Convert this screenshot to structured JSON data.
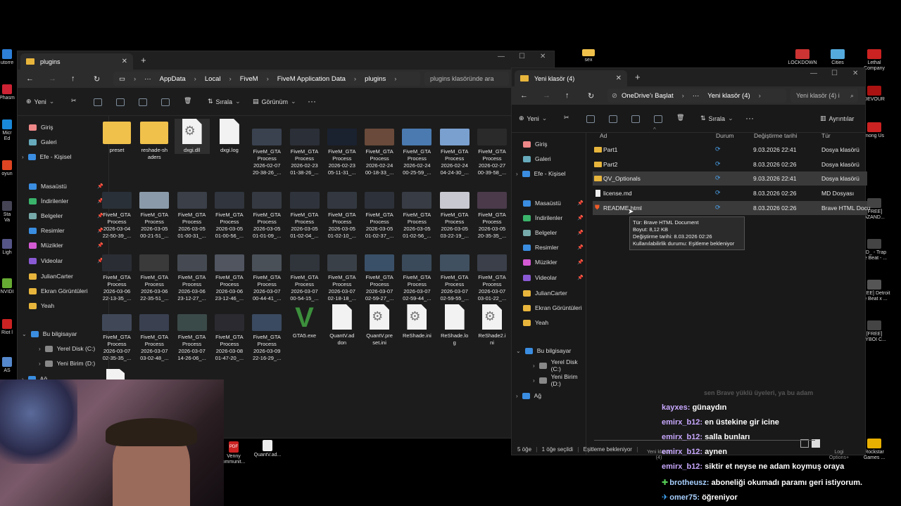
{
  "desktop_left": [
    {
      "label": "utorre",
      "color": "#2d7fd8"
    },
    {
      "label": "Phasm",
      "color": "#c23"
    },
    {
      "label": "Micr\nEd",
      "color": "#1a88d8"
    },
    {
      "label": "oyun",
      "color": "#d42"
    },
    {
      "label": "Sta\nVa",
      "color": "#445"
    },
    {
      "label": "Ligh",
      "color": "#558"
    },
    {
      "label": "NVIDI",
      "color": "#6a3"
    },
    {
      "label": "Riot l",
      "color": "#c22"
    },
    {
      "label": "AS",
      "color": "#58c"
    }
  ],
  "desktop_top": [
    {
      "label": "sex"
    }
  ],
  "desktop_right": [
    {
      "label": "LOCKDOWN",
      "color": "#c33"
    },
    {
      "label": "Cities",
      "color": "#5ad"
    },
    {
      "label": "Lethal\nCompany",
      "color": "#c22"
    },
    {
      "label": "DEVOUR",
      "color": "#a11"
    },
    {
      "label": "mong Us",
      "color": "#c22"
    },
    {
      "label": "[FREE]\nAZAND...",
      "color": "#444"
    },
    {
      "label": "ND_ - Trap\nne Beat - ...",
      "color": "#444"
    },
    {
      "label": "[FREE] Detroit\npe Beat x ...",
      "color": "#555"
    },
    {
      "label": "[FREE]\nAYBOI C...",
      "color": "#444"
    },
    {
      "label": "Rockstar\nGames ...",
      "color": "#e8b000"
    }
  ],
  "left_window": {
    "tab_title": "plugins",
    "path": [
      "AppData",
      "Local",
      "FiveM",
      "FiveM Application Data",
      "plugins"
    ],
    "search_placeholder": "plugins klasöründe ara",
    "toolbar": {
      "new": "Yeni",
      "sort": "Sırala",
      "view": "Görünüm",
      "more": "···"
    },
    "sidebar": [
      {
        "label": "Giriş",
        "color": "#e88",
        "pin": false
      },
      {
        "label": "Galeri",
        "color": "#6ab",
        "pin": false
      },
      {
        "label": "Efe - Kişisel",
        "color": "#3a8de0",
        "pin": false
      },
      {
        "label": "Masaüstü",
        "color": "#3a8de0",
        "pin": true
      },
      {
        "label": "İndirilenler",
        "color": "#3ab36b",
        "pin": true
      },
      {
        "label": "Belgeler",
        "color": "#7aa",
        "pin": true
      },
      {
        "label": "Resimler",
        "color": "#3a8de0",
        "pin": true
      },
      {
        "label": "Müzikler",
        "color": "#d45ad4",
        "pin": true
      },
      {
        "label": "Videolar",
        "color": "#8a5ad4",
        "pin": true
      },
      {
        "label": "JulianCarter",
        "color": "#e8b53c",
        "pin": false
      },
      {
        "label": "Ekran Görüntüleri",
        "color": "#e8b53c",
        "pin": false
      },
      {
        "label": "Yeah",
        "color": "#e8b53c",
        "pin": false
      },
      {
        "label": "Bu bilgisayar",
        "color": "#3a8de0",
        "pin": false
      },
      {
        "label": "Yerel Disk (C:)",
        "color": "#888",
        "pin": false
      },
      {
        "label": "Yeni Birim (D:)",
        "color": "#888",
        "pin": false
      },
      {
        "label": "Ağ",
        "color": "#3a8de0",
        "pin": false
      }
    ],
    "files": [
      {
        "name": "preset",
        "kind": "folder"
      },
      {
        "name": "reshade-sh\naders",
        "kind": "folder"
      },
      {
        "name": "dxgi.dll",
        "kind": "gear"
      },
      {
        "name": "dxgi.log",
        "kind": "doc"
      },
      {
        "name": "FiveM_GTA\nProcess\n2026-02-07\n20-38-26_...",
        "kind": "thumb",
        "color": "#3a4250"
      },
      {
        "name": "FiveM_GTA\nProcess\n2026-02-23\n01-38-26_...",
        "kind": "thumb",
        "color": "#2a2f38"
      },
      {
        "name": "FiveM_GTA\nProcess\n2026-02-23\n05-11-31_...",
        "kind": "thumb",
        "color": "#1a2230"
      },
      {
        "name": "FiveM_GTA\nProcess\n2026-02-24\n00-18-33_...",
        "kind": "thumb",
        "color": "#6a4a3a"
      },
      {
        "name": "FiveM_GTA\nProcess\n2026-02-24\n00-25-59_...",
        "kind": "thumb",
        "color": "#4a7ab0"
      },
      {
        "name": "FiveM_GTA\nProcess\n2026-02-24\n04-24-30_...",
        "kind": "thumb",
        "color": "#7aa0d0"
      },
      {
        "name": "FiveM_GTA\nProcess\n2026-02-27\n00-39-58_...",
        "kind": "thumb",
        "color": "#2a2a2a"
      },
      {
        "name": "FiveM_GTA\nProcess\n2026-03-04\n22-50-39_...",
        "kind": "thumb",
        "color": "#2a3038"
      },
      {
        "name": "FiveM_GTA\nProcess\n2026-03-05\n00-21-51_...",
        "kind": "thumb",
        "color": "#8a9aaa"
      },
      {
        "name": "FiveM_GTA\nProcess\n2026-03-05\n01-00-31_...",
        "kind": "thumb",
        "color": "#3a3f48"
      },
      {
        "name": "FiveM_GTA\nProcess\n2026-03-05\n01-00-56_...",
        "kind": "thumb",
        "color": "#30353e"
      },
      {
        "name": "FiveM_GTA\nProcess\n2026-03-05\n01-01-09_...",
        "kind": "thumb",
        "color": "#353a42"
      },
      {
        "name": "FiveM_GTA\nProcess\n2026-03-05\n01-02-04_...",
        "kind": "thumb",
        "color": "#2f343c"
      },
      {
        "name": "FiveM_GTA\nProcess\n2026-03-05\n01-02-10_...",
        "kind": "thumb",
        "color": "#333840"
      },
      {
        "name": "FiveM_GTA\nProcess\n2026-03-05\n01-02-37_...",
        "kind": "thumb",
        "color": "#2d323a"
      },
      {
        "name": "FiveM_GTA\nProcess\n2026-03-05\n01-02-56_...",
        "kind": "thumb",
        "color": "#383d45"
      },
      {
        "name": "FiveM_GTA\nProcess\n2026-03-05\n03-22-19_...",
        "kind": "thumb",
        "color": "#c8c8d0"
      },
      {
        "name": "FiveM_GTA\nProcess\n2026-03-05\n20-35-35_...",
        "kind": "thumb",
        "color": "#4a3a4a"
      },
      {
        "name": "FiveM_GTA\nProcess\n2026-03-06\n22-13-35_...",
        "kind": "thumb",
        "color": "#2a2e34"
      },
      {
        "name": "FiveM_GTA\nProcess\n2026-03-06\n22-35-51_...",
        "kind": "thumb",
        "color": "#3a3a3a"
      },
      {
        "name": "FiveM_GTA\nProcess\n2026-03-06\n23-12-27_...",
        "kind": "thumb",
        "color": "#454a52"
      },
      {
        "name": "FiveM_GTA\nProcess\n2026-03-06\n23-12-46_...",
        "kind": "thumb",
        "color": "#505560"
      },
      {
        "name": "FiveM_GTA\nProcess\n2026-03-07\n00-44-41_...",
        "kind": "thumb",
        "color": "#4a5058"
      },
      {
        "name": "FiveM_GTA\nProcess\n2026-03-07\n00-54-15_...",
        "kind": "thumb",
        "color": "#30353c"
      },
      {
        "name": "FiveM_GTA\nProcess\n2026-03-07\n02-18-18_...",
        "kind": "thumb",
        "color": "#3a4048"
      },
      {
        "name": "FiveM_GTA\nProcess\n2026-03-07\n02-59-27_...",
        "kind": "thumb",
        "color": "#3a5068"
      },
      {
        "name": "FiveM_GTA\nProcess\n2026-03-07\n02-59-44_...",
        "kind": "thumb",
        "color": "#3a4a5a"
      },
      {
        "name": "FiveM_GTA\nProcess\n2026-03-07\n02-59-55_...",
        "kind": "thumb",
        "color": "#405060"
      },
      {
        "name": "FiveM_GTA\nProcess\n2026-03-07\n03-01-22_...",
        "kind": "thumb",
        "color": "#3a3f4a"
      },
      {
        "name": "FiveM_GTA\nProcess\n2026-03-07\n02-35-35_...",
        "kind": "thumb",
        "color": "#404858"
      },
      {
        "name": "FiveM_GTA\nProcess\n2026-03-07\n03-02-48_...",
        "kind": "thumb",
        "color": "#3a4050"
      },
      {
        "name": "FiveM_GTA\nProcess\n2026-03-07\n14-26-06_...",
        "kind": "thumb",
        "color": "#3a4a48"
      },
      {
        "name": "FiveM_GTA\nProcess\n2026-03-08\n01-47-20_...",
        "kind": "thumb",
        "color": "#2a2a30"
      },
      {
        "name": "FiveM_GTA\nProcess\n2026-03-09\n22-16-29_...",
        "kind": "thumb",
        "color": "#3a4a60"
      },
      {
        "name": "GTA5.exe",
        "kind": "gta"
      },
      {
        "name": "QuantV.ad\ndon",
        "kind": "doc"
      },
      {
        "name": "QuantV.pre\nset.ini",
        "kind": "gear"
      },
      {
        "name": "ReShade.ini",
        "kind": "gear"
      },
      {
        "name": "ReShade.lo\ng",
        "kind": "doc"
      },
      {
        "name": "ReShade2.i\nni",
        "kind": "gear"
      }
    ]
  },
  "right_window": {
    "tab_title": "Yeni klasör (4)",
    "path": [
      "OneDrive'ı Başlat",
      "···",
      "Yeni klasör (4)"
    ],
    "search_placeholder": "Yeni klasör (4) i",
    "toolbar": {
      "new": "Yeni",
      "sort": "Sırala",
      "more": "···",
      "details": "Ayrıntılar"
    },
    "sidebar": [
      {
        "label": "Giriş",
        "color": "#e88",
        "pin": false
      },
      {
        "label": "Galeri",
        "color": "#6ab",
        "pin": false
      },
      {
        "label": "Efe - Kişisel",
        "color": "#3a8de0",
        "pin": false
      },
      {
        "label": "Masaüstü",
        "color": "#3a8de0",
        "pin": true
      },
      {
        "label": "İndirilenler",
        "color": "#3ab36b",
        "pin": true
      },
      {
        "label": "Belgeler",
        "color": "#7aa",
        "pin": true
      },
      {
        "label": "Resimler",
        "color": "#3a8de0",
        "pin": true
      },
      {
        "label": "Müzikler",
        "color": "#d45ad4",
        "pin": true
      },
      {
        "label": "Videolar",
        "color": "#8a5ad4",
        "pin": true
      },
      {
        "label": "JulianCarter",
        "color": "#e8b53c",
        "pin": false
      },
      {
        "label": "Ekran Görüntüleri",
        "color": "#e8b53c",
        "pin": false
      },
      {
        "label": "Yeah",
        "color": "#e8b53c",
        "pin": false
      },
      {
        "label": "Bu bilgisayar",
        "color": "#3a8de0",
        "pin": false
      },
      {
        "label": "Yerel Disk (C:)",
        "color": "#888",
        "pin": false
      },
      {
        "label": "Yeni Birim (D:)",
        "color": "#888",
        "pin": false
      },
      {
        "label": "Ağ",
        "color": "#3a8de0",
        "pin": false
      }
    ],
    "columns": {
      "name": "Ad",
      "status": "Durum",
      "modified": "Değiştirme tarihi",
      "type": "Tür"
    },
    "rows": [
      {
        "name": "Part1",
        "icon": "folder",
        "modified": "9.03.2026 22:41",
        "type": "Dosya klasörü",
        "selected": false
      },
      {
        "name": "Part2",
        "icon": "folder",
        "modified": "8.03.2026 02:26",
        "type": "Dosya klasörü",
        "selected": false
      },
      {
        "name": "QV_Optionals",
        "icon": "folder",
        "modified": "9.03.2026 22:41",
        "type": "Dosya klasörü",
        "selected": true
      },
      {
        "name": "license.md",
        "icon": "doc",
        "modified": "8.03.2026 02:26",
        "type": "MD Dosyası",
        "selected": false
      },
      {
        "name": "README.html",
        "icon": "brave",
        "modified": "8.03.2026 02:26",
        "type": "Brave HTML Docu",
        "selected": true
      }
    ],
    "tooltip": [
      "Tür: Brave HTML Document",
      "Boyut: 8,12 KB",
      "Değiştirme tarihi: 8.03.2026 02:26",
      "Kullanılabilirlik durumu: Eşitleme bekleniyor"
    ],
    "status_bar": {
      "count": "5 öğe",
      "selected": "1 öğe seçildi",
      "sync": "Eşitleme bekleniyor"
    }
  },
  "taskbar_items": [
    {
      "label": "Venny\nommunit...",
      "kind": "pdf"
    },
    {
      "label": "QuantV.ad...",
      "kind": "doc"
    },
    {
      "label": "Yeni klasör\n(4)",
      "kind": "folder"
    },
    {
      "label": "Logi\nOptions+",
      "kind": "app"
    }
  ],
  "chat": [
    {
      "user": "",
      "text": "sen Brave yüklü üyeleri, ya bu adam",
      "faded": true
    },
    {
      "user": "kayxes:",
      "text": "günaydın",
      "faded": false
    },
    {
      "user": "emirx_b12:",
      "text": "en üstekine gir icine",
      "faded": false
    },
    {
      "user": "emirx_b12:",
      "text": "salla bunları",
      "faded": false
    },
    {
      "user": "emirx_b12:",
      "text": "aynen",
      "faded": false
    },
    {
      "user": "emirx_b12:",
      "text": "siktir et neyse ne adam koymuş oraya",
      "faded": false
    },
    {
      "user": "brotheusz:",
      "text": "aboneliği okumadı paramı geri istiyorum.",
      "faded": false
    },
    {
      "user": "omer75:",
      "text": "öğreniyor",
      "faded": false
    }
  ]
}
